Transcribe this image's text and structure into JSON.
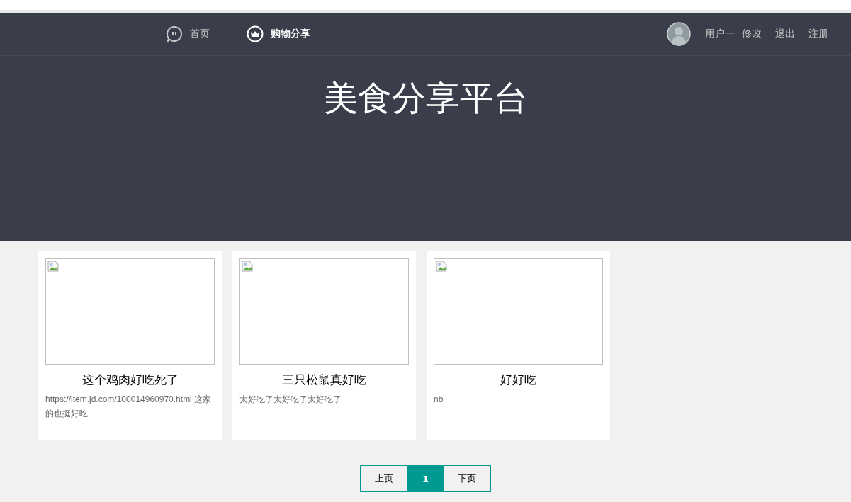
{
  "nav": {
    "items": [
      {
        "label": "首页",
        "kind": "chat",
        "selected": false
      },
      {
        "label": "购物分享",
        "kind": "crown",
        "selected": true
      }
    ],
    "user": {
      "name": "用户一",
      "links": [
        "修改",
        "退出",
        "注册"
      ]
    }
  },
  "hero": {
    "title": "美食分享平台"
  },
  "posts": [
    {
      "title": "这个鸡肉好吃死了",
      "text": "https://item.jd.com/100014960970.html 这家的也挺好吃"
    },
    {
      "title": "三只松鼠真好吃",
      "text": "太好吃了太好吃了太好吃了"
    },
    {
      "title": "好好吃",
      "text": "nb"
    }
  ],
  "pagination": [
    {
      "label": "上页",
      "selected": false
    },
    {
      "label": "1",
      "selected": true
    },
    {
      "label": "下页",
      "selected": false
    }
  ]
}
